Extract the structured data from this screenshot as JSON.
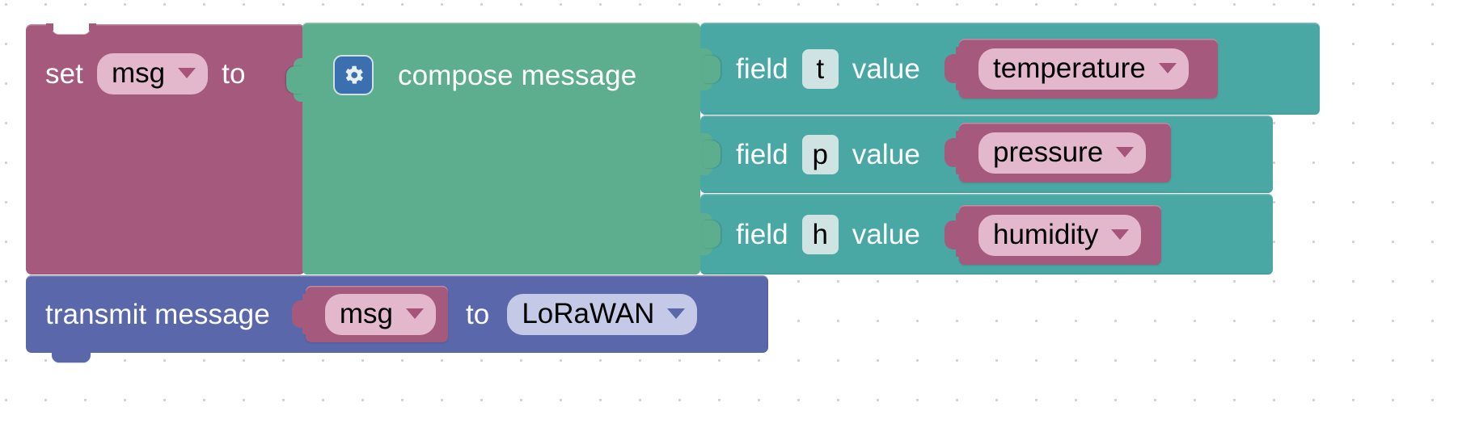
{
  "workspace": {
    "background_color": "#ffffff",
    "grid_dot_color": "#cfcfd4"
  },
  "colors": {
    "variable_block": "#a55a7d",
    "variable_field": "#e3b7cc",
    "compose_block": "#5cae8e",
    "field_row_block": "#4aa8a4",
    "field_key_input": "#cfe4e2",
    "transmit_block": "#5a68ab",
    "transmit_dropdown": "#c3c9e6",
    "gear_icon_button": "#3c6fb0"
  },
  "set_block": {
    "keyword": "set",
    "variable_dropdown": {
      "value": "msg",
      "icon": "chevron-down-icon"
    },
    "connector_word": "to"
  },
  "compose_block": {
    "mutator_icon": "gear-icon",
    "label": "compose message",
    "field_rows": [
      {
        "prefix_label": "field",
        "key": "t",
        "suffix_label": "value",
        "variable": {
          "value": "temperature",
          "icon": "chevron-down-icon"
        }
      },
      {
        "prefix_label": "field",
        "key": "p",
        "suffix_label": "value",
        "variable": {
          "value": "pressure",
          "icon": "chevron-down-icon"
        }
      },
      {
        "prefix_label": "field",
        "key": "h",
        "suffix_label": "value",
        "variable": {
          "value": "humidity",
          "icon": "chevron-down-icon"
        }
      }
    ]
  },
  "transmit_block": {
    "label": "transmit message",
    "message_variable": {
      "value": "msg",
      "icon": "chevron-down-icon"
    },
    "connector_word": "to",
    "target_dropdown": {
      "value": "LoRaWAN",
      "icon": "chevron-down-icon"
    }
  }
}
